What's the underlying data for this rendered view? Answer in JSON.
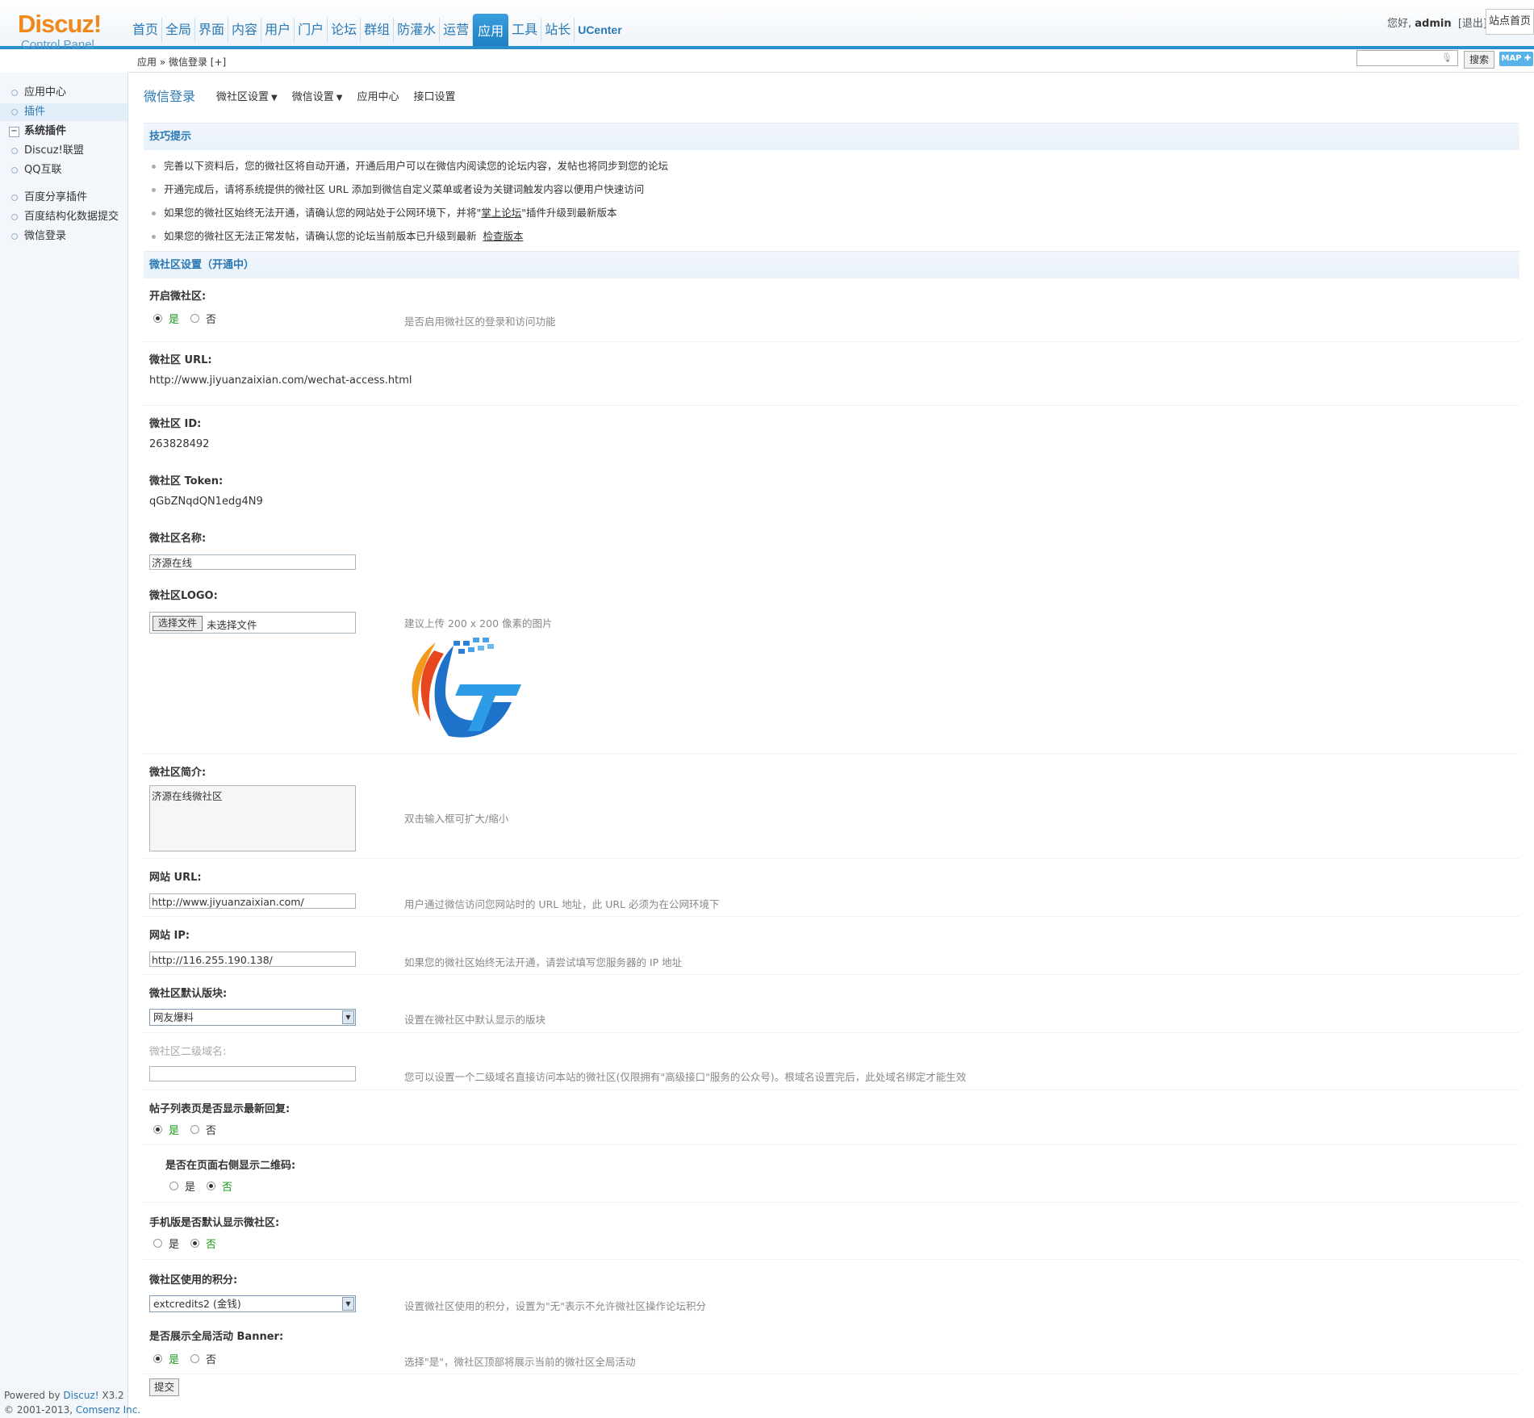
{
  "header": {
    "logo_text": "Discuz!",
    "logo_sub": "Control Panel",
    "nav": [
      "首页",
      "全局",
      "界面",
      "内容",
      "用户",
      "门户",
      "论坛",
      "群组",
      "防灌水",
      "运营",
      "应用",
      "工具",
      "站长",
      "UCenter"
    ],
    "active_nav": "应用",
    "user_greeting": "您好,",
    "username": "admin",
    "logout": "[退出]",
    "site_home": "站点首页"
  },
  "subheader": {
    "breadcrumb": "应用 » 微信登录  [+]",
    "search_button": "搜索",
    "map_button": "MAP ✚"
  },
  "sidebar": {
    "items": [
      "应用中心",
      "插件",
      "系统插件",
      "Discuz!联盟",
      "QQ互联",
      "百度分享插件",
      "百度结构化数据提交",
      "微信登录"
    ],
    "active": "插件",
    "powered_line1_prefix": "Powered by",
    "powered_line1_brand": "Discuz!",
    "powered_line1_version": "X3.2",
    "powered_line2_prefix": "© 2001-2013,",
    "powered_line2_company": "Comsenz Inc."
  },
  "tabs": {
    "title": "微信登录",
    "items": [
      "微社区设置",
      "微信设置",
      "应用中心",
      "接口设置"
    ]
  },
  "tips": {
    "heading": "技巧提示",
    "line1": "完善以下资料后，您的微社区将自动开通，开通后用户可以在微信内阅读您的论坛内容，发帖也将同步到您的论坛",
    "line2": "开通完成后，请将系统提供的微社区 URL 添加到微信自定义菜单或者设为关键词触发内容以便用户快速访问",
    "line3_pre": "如果您的微社区始终无法开通，请确认您的网站处于公网环境下，并将\"",
    "line3_link": "掌上论坛",
    "line3_post": "\"插件升级到最新版本",
    "line4_pre": "如果您的微社区无法正常发帖，请确认您的论坛当前版本已升级到最新",
    "line4_link": "检查版本"
  },
  "settings": {
    "heading": "微社区设置（开通中）",
    "open_label": "开启微社区:",
    "open_hint": "是否启用微社区的登录和访问功能",
    "yes": "是",
    "no": "否",
    "url_label": "微社区 URL:",
    "url_value": "http://www.jiyuanzaixian.com/wechat-access.html",
    "id_label": "微社区 ID:",
    "id_value": "263828492",
    "token_label": "微社区 Token:",
    "token_value": "qGbZNqdQN1edg4N9",
    "name_label": "微社区名称:",
    "name_value": "济源在线",
    "logo_label": "微社区LOGO:",
    "logo_choose": "选择文件",
    "logo_none": "未选择文件",
    "logo_hint": "建议上传 200 x 200 像素的图片",
    "intro_label": "微社区简介:",
    "intro_value": "济源在线微社区",
    "intro_hint": "双击输入框可扩大/缩小",
    "site_url_label": "网站 URL:",
    "site_url_value": "http://www.jiyuanzaixian.com/",
    "site_url_hint": "用户通过微信访问您网站时的 URL 地址，此 URL 必须为在公网环境下",
    "site_ip_label": "网站 IP:",
    "site_ip_value": "http://116.255.190.138/",
    "site_ip_hint": "如果您的微社区始终无法开通，请尝试填写您服务器的 IP 地址",
    "default_block_label": "微社区默认版块:",
    "default_block_value": "网友爆料",
    "default_block_hint": "设置在微社区中默认显示的版块",
    "subdomain_label": "微社区二级域名:",
    "subdomain_value": "",
    "subdomain_hint": "您可以设置一个二级域名直接访问本站的微社区(仅限拥有\"高级接口\"服务的公众号)。根域名设置完后，此处域名绑定才能生效",
    "list_reply_label": "帖子列表页是否显示最新回复:",
    "qrcode_label": "是否在页面右侧显示二维码:",
    "mobile_default_label": "手机版是否默认显示微社区:",
    "credit_label": "微社区使用的积分:",
    "credit_value": "extcredits2 (金钱)",
    "credit_hint": "设置微社区使用的积分，设置为\"无\"表示不允许微社区操作论坛积分",
    "banner_label": "是否展示全局活动 Banner:",
    "banner_hint": "选择\"是\"，微社区顶部将展示当前的微社区全局活动",
    "submit": "提交"
  },
  "colors": {
    "accent": "#2a78b4",
    "nav_active": "#2b8fcf",
    "logo": "#f0891b",
    "radio_on": "#1a9b1a"
  }
}
